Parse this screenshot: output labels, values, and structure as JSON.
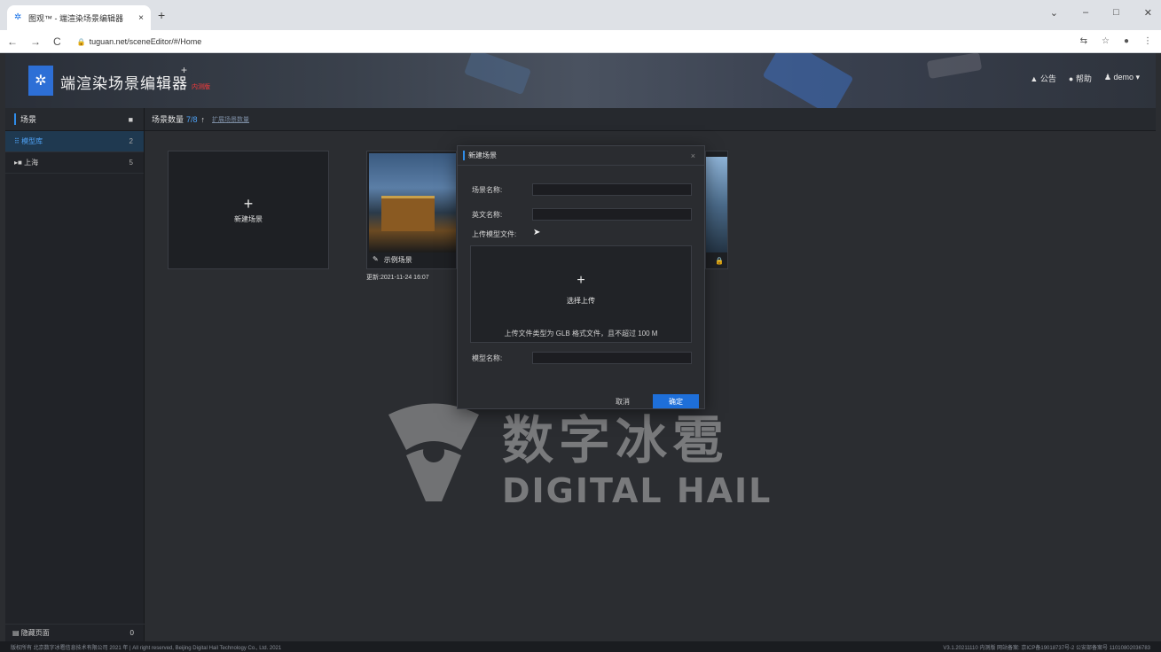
{
  "browser": {
    "tab_title": "图观™ - 端渲染场景编辑器",
    "tab_close": "×",
    "new_tab": "+",
    "url": "tuguan.net/sceneEditor/#/Home",
    "win_min": "–",
    "win_max": "□",
    "win_close": "✕"
  },
  "header": {
    "app_title": "端渲染场景编辑器",
    "app_plus": "+",
    "badge": "内测版",
    "notice": "公告",
    "help": "帮助",
    "user": "demo"
  },
  "sidebar": {
    "title": "场景",
    "items": [
      {
        "label": "模型库",
        "count": "2"
      },
      {
        "label": "上海",
        "count": "5"
      }
    ],
    "footer_label": "隐藏页面",
    "footer_count": "0"
  },
  "toolbar": {
    "label": "场景数量",
    "count": "7/8",
    "up": "↑",
    "expand_link": "扩展场景数量"
  },
  "main": {
    "new_scene_plus": "+",
    "new_scene_label": "新建场景",
    "scene_name": "示例场景",
    "scene_date": "更新:2021-11-24 16:07"
  },
  "modal": {
    "title": "新建场景",
    "close": "×",
    "field_scene_name": "场景名称:",
    "field_en_name": "英文名称:",
    "field_upload": "上传模型文件:",
    "upload_plus": "+",
    "upload_label": "选择上传",
    "upload_hint": "上传文件类型为 GLB 格式文件，且不超过 100 M",
    "field_model_name": "模型名称:",
    "cancel": "取消",
    "ok": "确定"
  },
  "watermark": {
    "cn": "数字冰雹",
    "en": "DIGITAL HAIL"
  },
  "footer": {
    "left": "版权所有 北京数字冰雹信息技术有限公司 2021 年 | All right reserved, Beijing Digital Hail Technology Co., Ltd. 2021",
    "right": "V3.1.20211110 内测版 网站备案: 京ICP备19018737号-2 公安部备案号 11010802036783"
  },
  "colors": {
    "accent": "#2f8ce8",
    "primary_button": "#1e6fd9",
    "badge": "#ff3b3b"
  }
}
